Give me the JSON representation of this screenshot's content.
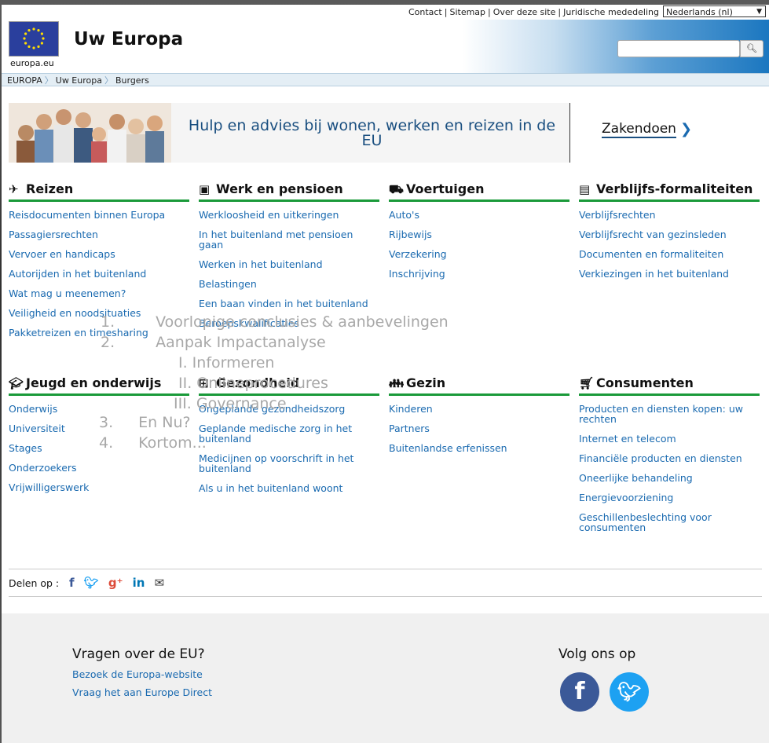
{
  "topbar": {
    "links": [
      "Contact",
      "Sitemap",
      "Over deze site",
      "Juridische mededeling"
    ],
    "language": "Nederlands (nl)"
  },
  "header": {
    "logo_text": "europa.eu",
    "title": "Uw Europa",
    "search_placeholder": ""
  },
  "breadcrumb": [
    "EUROPA",
    "Uw Europa",
    "Burgers"
  ],
  "banner": {
    "title": "Hulp en advies bij wonen, werken en reizen in de EU",
    "zakendoen": "Zakendoen"
  },
  "categories": [
    {
      "title": "Reizen",
      "icon": "plane-icon",
      "items": [
        "Reisdocumenten binnen Europa",
        "Passagiersrechten",
        "Vervoer en handicaps",
        "Autorijden in het buitenland",
        "Wat mag u meenemen?",
        "Veiligheid en noodsituaties",
        "Pakketreizen en timesharing"
      ]
    },
    {
      "title": "Werk en pensioen",
      "icon": "briefcase-icon",
      "items": [
        "Werkloosheid en uitkeringen",
        "In het buitenland met pensioen gaan",
        "Werken in het buitenland",
        "Belastingen",
        "Een baan vinden in het buitenland",
        "Beroepskwalificaties"
      ]
    },
    {
      "title": "Voertuigen",
      "icon": "car-icon",
      "items": [
        "Auto's",
        "Rijbewijs",
        "Verzekering",
        "Inschrijving"
      ]
    },
    {
      "title": "Verblijfs-formaliteiten",
      "icon": "id-card-icon",
      "items": [
        "Verblijfsrechten",
        "Verblijfsrecht van gezinsleden",
        "Documenten en formaliteiten",
        "Verkiezingen in het buitenland"
      ]
    },
    {
      "title": "Jeugd en onderwijs",
      "icon": "graduation-cap-icon",
      "items": [
        "Onderwijs",
        "Universiteit",
        "Stages",
        "Onderzoekers",
        "Vrijwilligerswerk"
      ]
    },
    {
      "title": "Gezondheid",
      "icon": "medical-kit-icon",
      "items": [
        "Ongeplande gezondheidszorg",
        "Geplande medische zorg in het buitenland",
        "Medicijnen op voorschrift in het buitenland",
        "Als u in het buitenland woont"
      ]
    },
    {
      "title": "Gezin",
      "icon": "family-icon",
      "items": [
        "Kinderen",
        "Partners",
        "Buitenlandse erfenissen"
      ]
    },
    {
      "title": "Consumenten",
      "icon": "shopping-cart-icon",
      "items": [
        "Producten en diensten kopen: uw rechten",
        "Internet en telecom",
        "Financiële producten en diensten",
        "Oneerlijke behandeling",
        "Energievoorziening",
        "Geschillenbeslechting voor consumenten"
      ]
    }
  ],
  "overlay": {
    "line1_num": "1.",
    "line1": "Voorlopige conclusies & aanbevelingen",
    "line2_num": "2.",
    "line2": "Aanpak Impactanalyse",
    "sub1": "I. Informeren",
    "sub2": "II. Onlineprocedures",
    "sub3": "III. Governance",
    "line3_num": "3.",
    "line3": "En Nu?",
    "line4_num": "4.",
    "line4": "Kortom..."
  },
  "share": {
    "label": "Delen op :",
    "icons": [
      "facebook-icon",
      "twitter-icon",
      "google-plus-icon",
      "linkedin-icon",
      "email-icon"
    ]
  },
  "footer": {
    "questions_title": "Vragen over de EU?",
    "link1": "Bezoek de Europa-website",
    "link2": "Vraag het aan Europe Direct",
    "follow_title": "Volg ons op",
    "facebook_color": "#3b5998",
    "twitter_color": "#1da1f2"
  },
  "colors": {
    "accent_green": "#1a9a3a",
    "link_blue": "#1a6ab0",
    "header_blue": "#1b77c0"
  }
}
